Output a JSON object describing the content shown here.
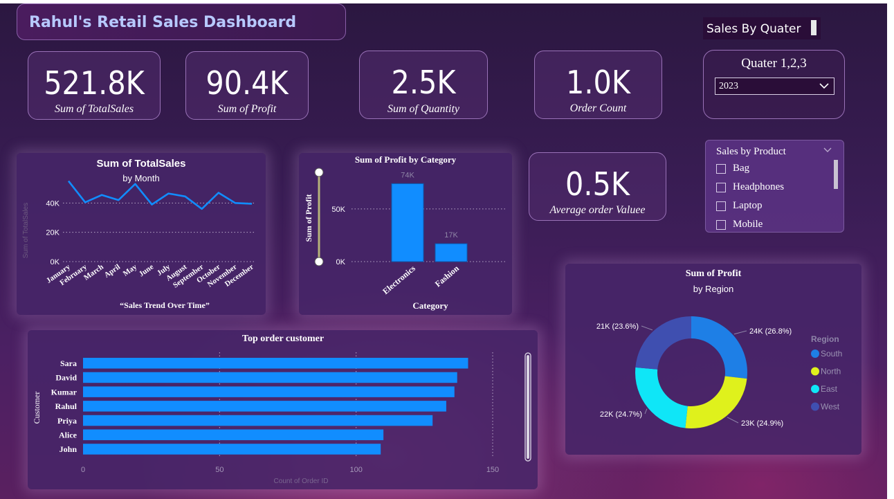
{
  "header": {
    "title": "Rahul's Retail Sales Dashboard",
    "quarter_toggle_label": "Sales By Quater"
  },
  "kpis": [
    {
      "value": "521.8K",
      "label": "Sum of TotalSales"
    },
    {
      "value": "90.4K",
      "label": "Sum of Profit"
    },
    {
      "value": "2.5K",
      "label": "Sum of Quantity"
    },
    {
      "value": "1.0K",
      "label": "Order Count"
    },
    {
      "value": "0.5K",
      "label": "Average order Valuee"
    }
  ],
  "quarter_filter": {
    "title": "Quater 1,2,3",
    "selected": "2023"
  },
  "product_slicer": {
    "title": "Sales by Product",
    "items": [
      "Bag",
      "Headphones",
      "Laptop",
      "Mobile"
    ]
  },
  "colors": {
    "bar_blue": "#118dff",
    "south": "#1e7fe6",
    "north": "#dff11c",
    "east": "#0fe6f7",
    "west": "#3f4fb0"
  },
  "chart_data": [
    {
      "type": "line",
      "title": "Sum of TotalSales",
      "subtitle": "by Month",
      "caption": "“Sales Trend Over Time”",
      "ylabel": "Sum of TotalSales",
      "x": [
        "January",
        "February",
        "March",
        "April",
        "May",
        "June",
        "July",
        "August",
        "September",
        "October",
        "November",
        "December"
      ],
      "values": [
        55,
        40.5,
        45.5,
        42,
        53,
        39,
        46.5,
        44.5,
        36,
        47,
        40,
        39.5
      ],
      "ylim": [
        0,
        60
      ],
      "yticks": [
        "0K",
        "20K",
        "40K"
      ],
      "grid": true
    },
    {
      "type": "bar",
      "title": "Sum of Profit by Category",
      "xlabel": "Category",
      "ylabel": "Sum of Profit",
      "categories": [
        "Electronics",
        "Fashion"
      ],
      "values": [
        74,
        17
      ],
      "data_labels": [
        "74K",
        "17K"
      ],
      "ylim": [
        0,
        90
      ],
      "yticks": [
        "0K",
        "50K"
      ],
      "grid": true
    },
    {
      "type": "bar",
      "orientation": "horizontal",
      "title": "Top order customer",
      "ylabel": "Customer",
      "xlabel": "Count of Order ID",
      "categories": [
        "Sara",
        "David",
        "Kumar",
        "Rahul",
        "Priya",
        "Alice",
        "John"
      ],
      "values": [
        141,
        137,
        136,
        133,
        128,
        110,
        109
      ],
      "xlim": [
        0,
        160
      ],
      "xticks": [
        "0",
        "50",
        "100",
        "150"
      ],
      "grid": true
    },
    {
      "type": "pie",
      "title": "Sum of Profit",
      "subtitle": "by Region",
      "legend_title": "Region",
      "legend_position": "right",
      "slices": [
        {
          "name": "South",
          "value": 24,
          "label": "24K (26.8%)"
        },
        {
          "name": "North",
          "value": 23,
          "label": "23K (24.9%)"
        },
        {
          "name": "East",
          "value": 22,
          "label": "22K (24.7%)"
        },
        {
          "name": "West",
          "value": 21,
          "label": "21K (23.6%)"
        }
      ],
      "percents": [
        26.8,
        24.9,
        24.7,
        23.6
      ]
    }
  ]
}
